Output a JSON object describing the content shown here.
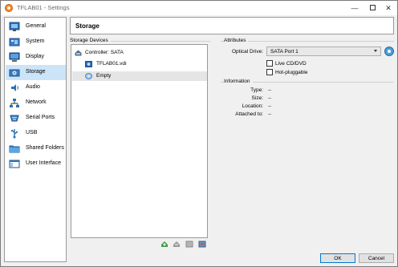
{
  "window": {
    "title": "TFLAB01 - Settings"
  },
  "titlebar": {
    "minimize": "—",
    "close": "✕"
  },
  "sidebar": {
    "items": [
      {
        "label": "General",
        "icon": "general-icon"
      },
      {
        "label": "System",
        "icon": "system-icon"
      },
      {
        "label": "Display",
        "icon": "display-icon"
      },
      {
        "label": "Storage",
        "icon": "storage-icon",
        "active": true
      },
      {
        "label": "Audio",
        "icon": "audio-icon"
      },
      {
        "label": "Network",
        "icon": "network-icon"
      },
      {
        "label": "Serial Ports",
        "icon": "serial-ports-icon"
      },
      {
        "label": "USB",
        "icon": "usb-icon"
      },
      {
        "label": "Shared Folders",
        "icon": "shared-folders-icon"
      },
      {
        "label": "User Interface",
        "icon": "user-interface-icon"
      }
    ]
  },
  "header": {
    "title": "Storage"
  },
  "storage_devices": {
    "label": "Storage Devices",
    "tree": [
      {
        "label": "Controller: SATA",
        "icon": "controller-icon"
      },
      {
        "label": "TFLAB01.vdi",
        "icon": "hard-disk-icon"
      },
      {
        "label": "Empty",
        "icon": "optical-disc-icon",
        "selected": true
      }
    ],
    "toolbar": [
      "add-controller-icon",
      "remove-controller-icon",
      "add-attachment-icon",
      "remove-attachment-icon"
    ]
  },
  "attributes": {
    "label": "Attributes",
    "optical_drive_label": "Optical Drive:",
    "optical_drive_value": "SATA Port 1",
    "live_cd_label": "Live CD/DVD",
    "hot_pluggable_label": "Hot-pluggable"
  },
  "information": {
    "label": "Information",
    "rows": [
      {
        "label": "Type:",
        "value": "--"
      },
      {
        "label": "Size:",
        "value": "--"
      },
      {
        "label": "Location:",
        "value": "--"
      },
      {
        "label": "Attached to:",
        "value": "--"
      }
    ]
  },
  "buttons": {
    "ok": "OK",
    "cancel": "Cancel"
  },
  "colors": {
    "selection": "#cce4f7",
    "accent": "#0078d7"
  }
}
